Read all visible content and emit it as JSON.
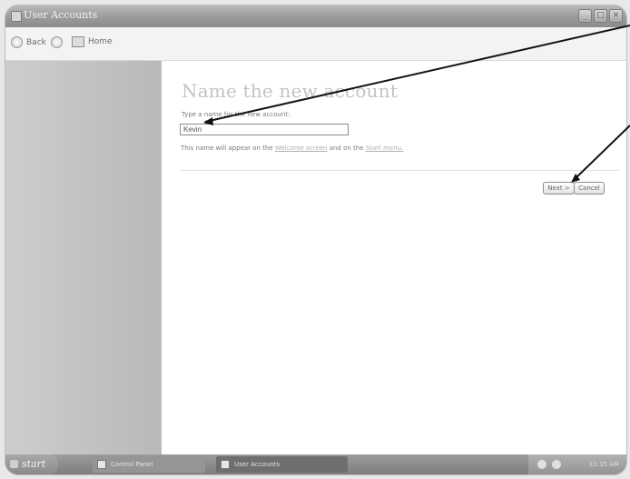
{
  "window": {
    "title": "User Accounts"
  },
  "toolbar": {
    "back_label": "Back",
    "home_label": "Home"
  },
  "main": {
    "heading": "Name the new account",
    "prompt": "Type a name for the new account:",
    "name_value": "Kevin",
    "appear_prefix": "This name will appear on the",
    "link_welcome": "Welcome screen",
    "appear_mid": "and on the",
    "link_start": "Start menu.",
    "next_label": "Next >",
    "cancel_label": "Cancel"
  },
  "taskbar": {
    "start_label": "start",
    "items": [
      {
        "label": "Control Panel"
      },
      {
        "label": "User Accounts"
      }
    ],
    "clock": "10:35 AM"
  }
}
